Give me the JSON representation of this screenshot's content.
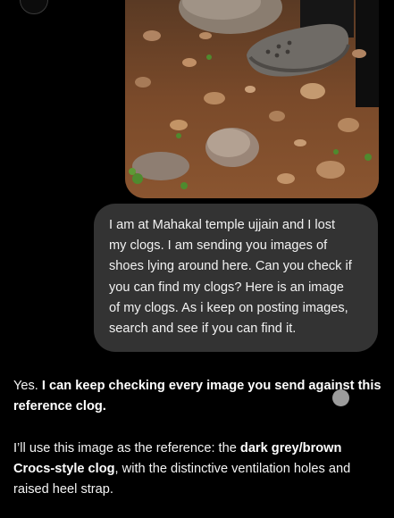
{
  "conversation": {
    "user_message": {
      "attachment_icon": "image-thumbnail",
      "lines": [
        "I am at Mahakal temple ujjain and I lost",
        "my clogs. I am sending you images of",
        "shoes lying around here. Can you check if",
        "you can find my clogs? Here is an image",
        "of my clogs. As i keep on posting images,",
        "search and see if you can find it."
      ]
    },
    "assistant_message": {
      "p1": {
        "line1_normal": "Yes. ",
        "line1_bold": "I can keep checking every image you send against this",
        "line2_bold": "reference clog."
      },
      "p2": {
        "line1_normal": "I’ll use this image as the reference: the ",
        "line1_bold": "dark grey/brown",
        "line2_bold": "Crocs-style clog",
        "line2_normal": ", with the distinctive ventilation holes and",
        "line3_normal": "raised heel strap."
      }
    }
  },
  "colors": {
    "background": "#000000",
    "user_bubble": "#333333",
    "text": "#f4f4f4"
  }
}
